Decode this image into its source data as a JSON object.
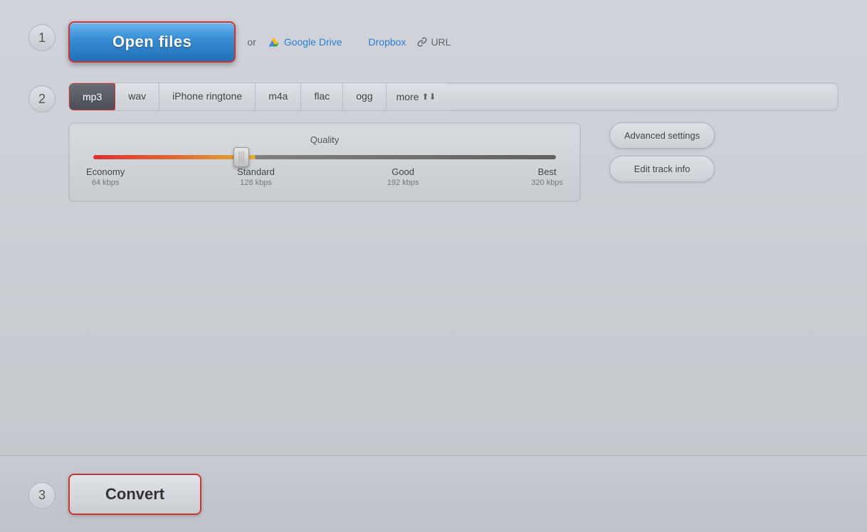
{
  "steps": {
    "step1": {
      "number": "1",
      "open_files_label": "Open files",
      "or_text": "or",
      "google_drive_label": "Google Drive",
      "dropbox_label": "Dropbox",
      "url_label": "URL"
    },
    "step2": {
      "number": "2",
      "tabs": [
        {
          "id": "mp3",
          "label": "mp3",
          "active": true
        },
        {
          "id": "wav",
          "label": "wav",
          "active": false
        },
        {
          "id": "iphone-ringtone",
          "label": "iPhone ringtone",
          "active": false
        },
        {
          "id": "m4a",
          "label": "m4a",
          "active": false
        },
        {
          "id": "flac",
          "label": "flac",
          "active": false
        },
        {
          "id": "ogg",
          "label": "ogg",
          "active": false
        },
        {
          "id": "more",
          "label": "more",
          "active": false
        }
      ],
      "quality": {
        "label": "Quality",
        "markers": [
          {
            "label": "Economy",
            "sublabel": "64 kbps"
          },
          {
            "label": "Standard",
            "sublabel": "128 kbps"
          },
          {
            "label": "Good",
            "sublabel": "192 kbps"
          },
          {
            "label": "Best",
            "sublabel": "320 kbps"
          }
        ]
      },
      "advanced_settings_label": "Advanced settings",
      "edit_track_info_label": "Edit track info"
    },
    "step3": {
      "number": "3",
      "convert_label": "Convert"
    }
  }
}
